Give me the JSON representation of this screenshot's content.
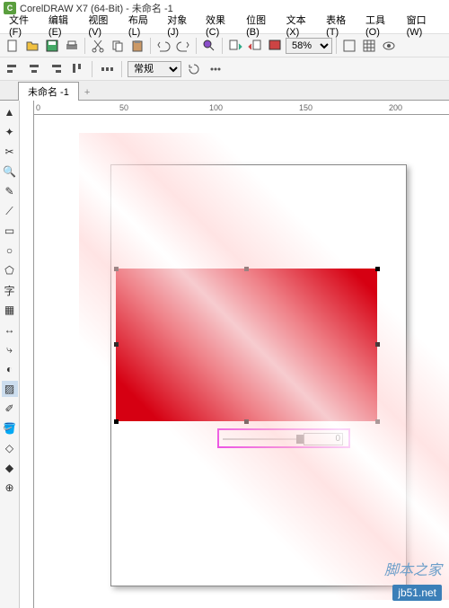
{
  "title": "CorelDRAW X7 (64-Bit) - 未命名 -1",
  "menu": [
    "文件(F)",
    "编辑(E)",
    "视图(V)",
    "布局(L)",
    "对象(J)",
    "效果(C)",
    "位图(B)",
    "文本(X)",
    "表格(T)",
    "工具(O)",
    "窗口(W)"
  ],
  "zoom": "58%",
  "style": "常规",
  "tab": "未命名 -1",
  "ruler_ticks": [
    0,
    50,
    100,
    150,
    200
  ],
  "percent_value": "0",
  "watermark_url": "jb51.net",
  "watermark_text": "脚本之家"
}
